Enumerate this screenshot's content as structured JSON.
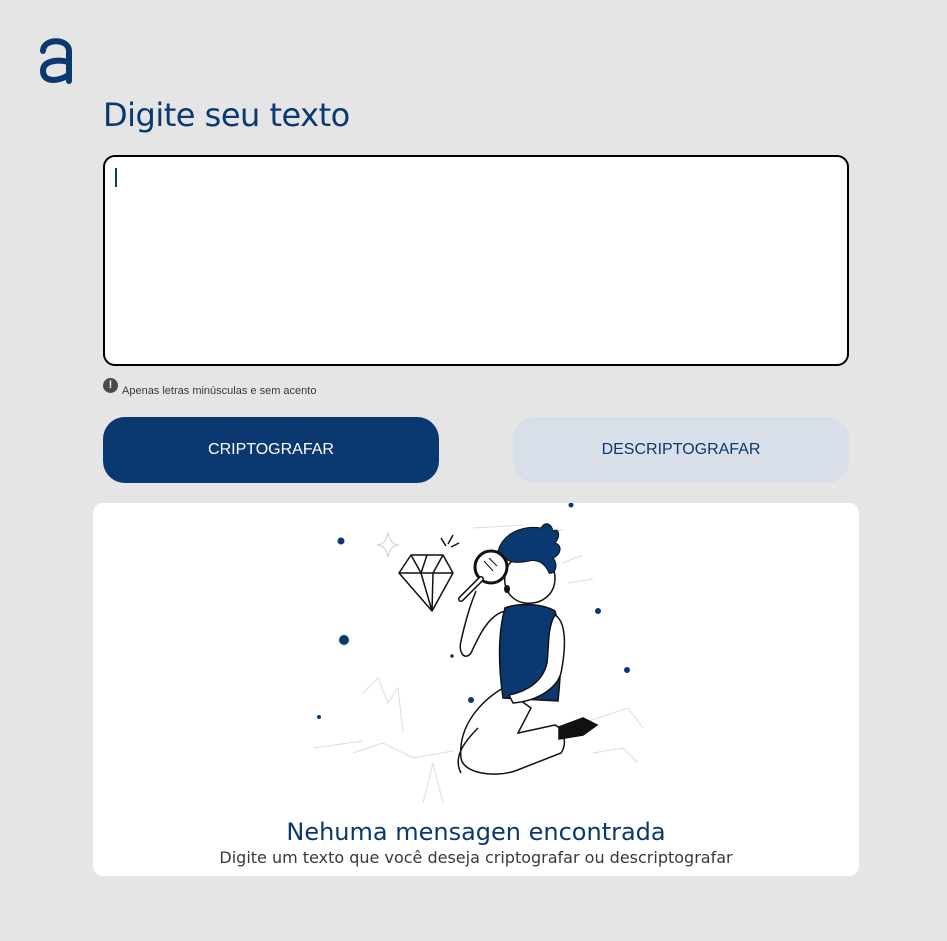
{
  "header": {
    "logo_icon": "alura-a-logo"
  },
  "main": {
    "title": "Digite seu texto",
    "input": {
      "value": "",
      "placeholder": ""
    },
    "hint": {
      "icon": "exclamation-circle-icon",
      "icon_glyph": "!",
      "text": "Apenas letras minúsculas e sem acento"
    },
    "buttons": {
      "encrypt_label": "CRIPTOGRAFAR",
      "decrypt_label": "DESCRIPTOGRAFAR"
    }
  },
  "output": {
    "illustration": "person-with-magnifying-glass-and-diamond",
    "empty_title": "Nehuma mensagen encontrada",
    "empty_subtitle": "Digite um texto que você deseja criptografar ou descriptografar"
  },
  "colors": {
    "primary": "#0a3871",
    "background": "#e5e5e5",
    "secondary_button": "#d8dfe8"
  }
}
